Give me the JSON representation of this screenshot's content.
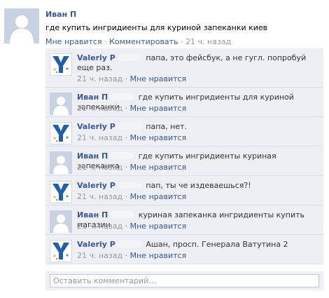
{
  "post": {
    "author": "Иван П",
    "text": "где купить ингридиенты для куриной запеканки киев",
    "like_label": "Мне нравится",
    "separator": "·",
    "comment_label": "Комментировать",
    "time": "21 ч. назад"
  },
  "comments": [
    {
      "author": "Valeriy P",
      "avatar": "valeriy",
      "text": "папа, это фейсбук, а не гугл. попробуй еще раз.",
      "time": "21 ч. назад",
      "like_label": "Мне нравится"
    },
    {
      "author": "Иван П",
      "avatar": "default",
      "text": "где купить ингридиенты для куриной запеканки",
      "time": "21 ч. назад",
      "like_label": "Мне нравится"
    },
    {
      "author": "Valeriy P",
      "avatar": "valeriy",
      "text": "папа, нет.",
      "time": "21 ч. назад",
      "like_label": "Мне нравится"
    },
    {
      "author": "Иван П",
      "avatar": "default",
      "text": "где купить ингридиенты куриная запеканка",
      "time": "21 ч. назад",
      "like_label": "Мне нравится"
    },
    {
      "author": "Valeriy P",
      "avatar": "valeriy",
      "text": "пап, ты че издеваешься?!",
      "time": "21 ч. назад",
      "like_label": "Мне нравится"
    },
    {
      "author": "Иван П",
      "avatar": "default",
      "text": "куриная запеканка ингридиенты купить магазин",
      "time": "21 ч. назад",
      "like_label": "Мне нравится"
    },
    {
      "author": "Valeriy P",
      "avatar": "valeriy",
      "text": "Ашан,  просп. Генерала Ватутина 2",
      "time": "21 ч. назад",
      "like_label": "Мне нравится"
    }
  ],
  "add_comment": {
    "placeholder": "Оставить комментарий..."
  },
  "colors": {
    "link": "#3b5998",
    "comment_bg": "#edeff4",
    "meta": "#999999"
  }
}
